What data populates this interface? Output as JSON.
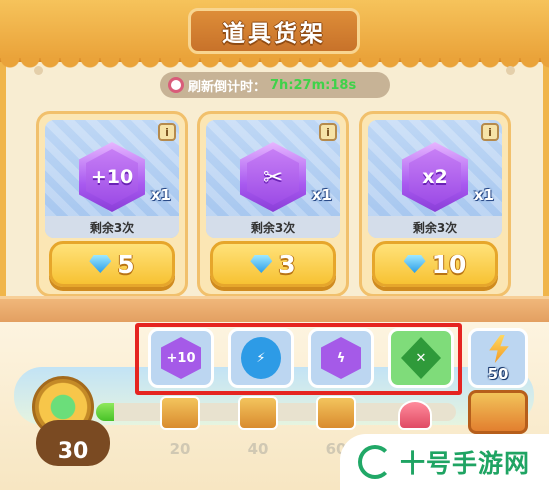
{
  "shop": {
    "title": "道具货架",
    "refresh": {
      "label": "刷新倒计时：",
      "countdown": "7h:27m:18s"
    },
    "items": [
      {
        "name": "plus-10",
        "icon_text": "+10",
        "quantity": "x1",
        "remaining": "剩余3次",
        "price": "5",
        "gem_icon": "plus10-gem-icon"
      },
      {
        "name": "scissors",
        "icon_text": "✂",
        "quantity": "x1",
        "remaining": "剩余3次",
        "price": "3",
        "gem_icon": "scissors-gem-icon"
      },
      {
        "name": "times-2",
        "icon_text": "x2",
        "quantity": "x1",
        "remaining": "剩余3次",
        "price": "10",
        "gem_icon": "times2-gem-icon"
      }
    ],
    "info_label": "i",
    "currency_icon": "diamond-icon"
  },
  "powerups": [
    {
      "label": "+10",
      "icon": "plus10-powerup-icon",
      "color": "#a55ae8"
    },
    {
      "label": "⚡",
      "icon": "lightning-orb-icon",
      "color": "#2d9be6"
    },
    {
      "label": "ϟ",
      "icon": "lightning-gem-icon",
      "color": "#a55ae8"
    },
    {
      "label": "✕",
      "icon": "shuffle-diamond-icon",
      "color": "#4cc04a"
    }
  ],
  "energy": {
    "count": "50",
    "icon": "energy-bolt-icon"
  },
  "progress": {
    "level": "30",
    "fill_fraction": 0.05,
    "milestones": [
      "20",
      "40",
      "60"
    ]
  },
  "colors": {
    "frame": "#f0b54a",
    "highlight": "#e52420",
    "countdown": "#3fd24a"
  },
  "watermark": {
    "text": "十号手游网"
  }
}
